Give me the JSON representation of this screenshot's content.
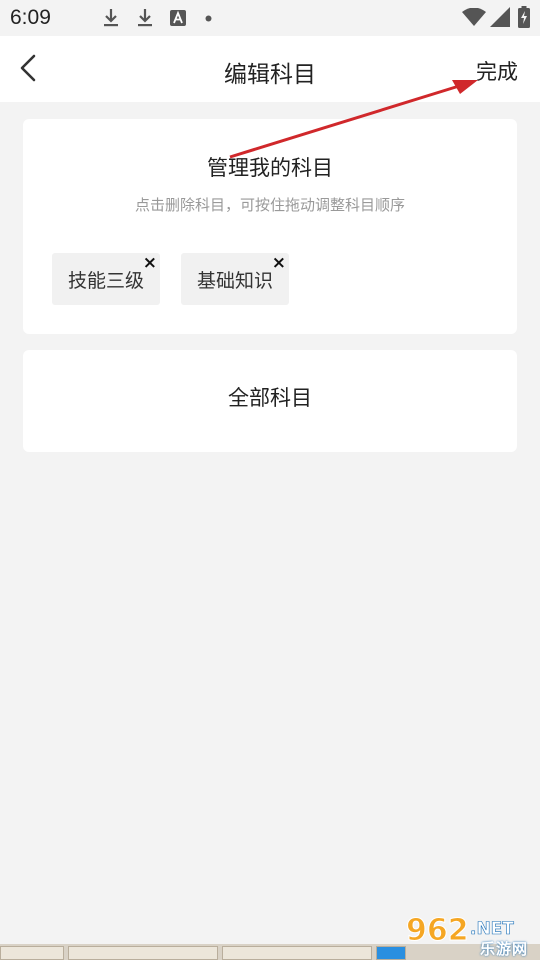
{
  "status_bar": {
    "time": "6:09",
    "left_icons": [
      "download-icon",
      "download-icon",
      "text-a-icon",
      "dot-icon"
    ],
    "right_icons": [
      "wifi-icon",
      "signal-icon",
      "battery-charging-icon"
    ]
  },
  "header": {
    "back_icon": "chevron-left-icon",
    "title": "编辑科目",
    "done_label": "完成"
  },
  "my_subjects": {
    "title": "管理我的科目",
    "hint": "点击删除科目，可按住拖动调整科目顺序",
    "tags": [
      {
        "label": "技能三级",
        "close": "×"
      },
      {
        "label": "基础知识",
        "close": "×"
      }
    ]
  },
  "all_subjects": {
    "title": "全部科目"
  },
  "annotation": {
    "arrow_color": "#d0282b"
  },
  "watermark": {
    "text": "乐游网"
  },
  "colors": {
    "background": "#f3f3f3",
    "card": "#ffffff",
    "tag_bg": "#f1f1f1",
    "hint_text": "#999999"
  }
}
